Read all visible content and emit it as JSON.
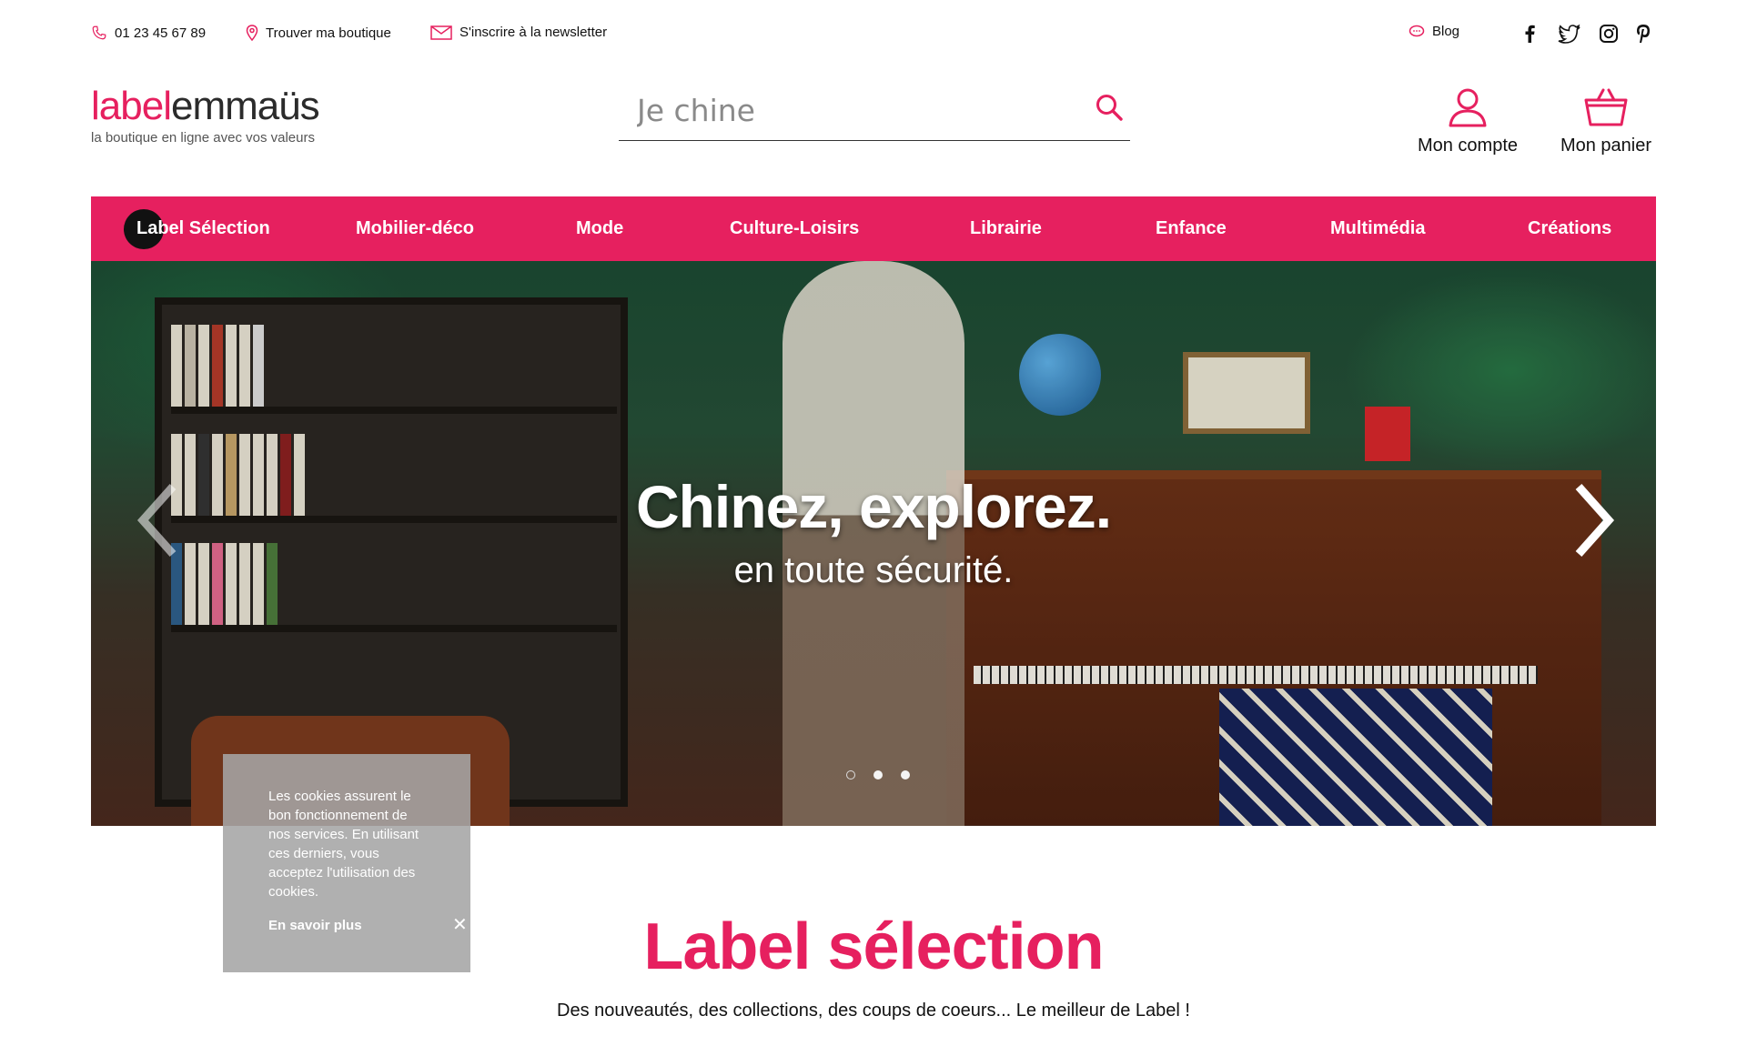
{
  "topbar": {
    "phone": "01 23 45 67 89",
    "store_locator": "Trouver ma boutique",
    "newsletter": "S'inscrire à la newsletter",
    "blog": "Blog",
    "social_icons": [
      "facebook-icon",
      "twitter-icon",
      "instagram-icon",
      "pinterest-icon"
    ]
  },
  "brand": {
    "logo_part1": "label",
    "logo_part2": "emmaüs",
    "tagline": "la boutique en ligne avec vos valeurs"
  },
  "search": {
    "placeholder": "Je chine"
  },
  "header": {
    "account_label": "Mon compte",
    "cart_label": "Mon panier"
  },
  "nav": {
    "items": [
      {
        "label": "Label Sélection"
      },
      {
        "label": "Mobilier-déco"
      },
      {
        "label": "Mode"
      },
      {
        "label": "Culture-Loisirs"
      },
      {
        "label": "Librairie"
      },
      {
        "label": "Enfance"
      },
      {
        "label": "Multimédia"
      },
      {
        "label": "Créations"
      }
    ]
  },
  "hero": {
    "headline": "Chinez, explorez.",
    "subline": "en toute sécurité.",
    "slide_count": 3,
    "active_slide": 1
  },
  "section": {
    "title": "Label sélection",
    "subtitle": "Des nouveautés, des collections, des coups de coeurs... Le meilleur de Label !"
  },
  "cookie": {
    "text": "Les cookies assurent le bon fonctionnement de nos services. En utilisant ces derniers, vous acceptez l'utilisation des cookies.",
    "more_label": "En savoir plus",
    "close_symbol": "✕"
  },
  "colors": {
    "brand_pink": "#e6205f",
    "text_dark": "#111111"
  }
}
